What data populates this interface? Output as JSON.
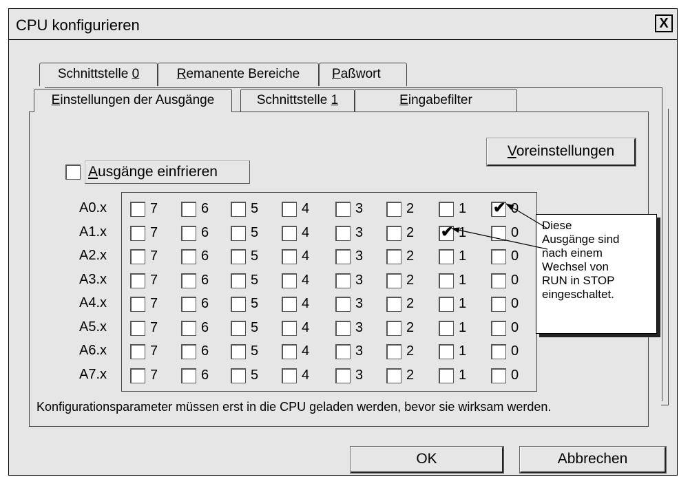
{
  "window": {
    "title": "CPU konfigurieren",
    "close_label": "X"
  },
  "tabs_back": [
    {
      "pre": "Schnittstelle ",
      "key": "0",
      "post": ""
    },
    {
      "pre": "",
      "key": "R",
      "post": "emanente Bereiche"
    },
    {
      "pre": "",
      "key": "P",
      "post": "aßwort"
    }
  ],
  "tabs_front": [
    {
      "pre": "",
      "key": "E",
      "post": "instellungen der Ausgänge",
      "active": true
    },
    {
      "pre": "Schnittstelle ",
      "key": "1",
      "post": ""
    },
    {
      "pre": "",
      "key": "E",
      "post": "ingabefilter"
    }
  ],
  "freeze": {
    "key": "A",
    "rest": "usgänge einfrieren",
    "checked": false
  },
  "defaults_button": {
    "key": "V",
    "rest": "oreinstellungen"
  },
  "rows": [
    "A0.x",
    "A1.x",
    "A2.x",
    "A3.x",
    "A4.x",
    "A5.x",
    "A6.x",
    "A7.x"
  ],
  "bits": [
    "7",
    "6",
    "5",
    "4",
    "3",
    "2",
    "1",
    "0"
  ],
  "checked": [
    "A0.x.0",
    "A1.x.1"
  ],
  "note": "Konfigurationsparameter müssen erst in die CPU geladen werden, bevor sie wirksam werden.",
  "callout": [
    "Diese",
    "Ausgänge sind",
    "nach einem",
    "Wechsel von",
    "RUN in STOP",
    "eingeschaltet."
  ],
  "buttons": {
    "ok": "OK",
    "cancel": "Abbrechen"
  },
  "icons": {
    "check": "checkmark-icon",
    "close": "close-icon"
  }
}
